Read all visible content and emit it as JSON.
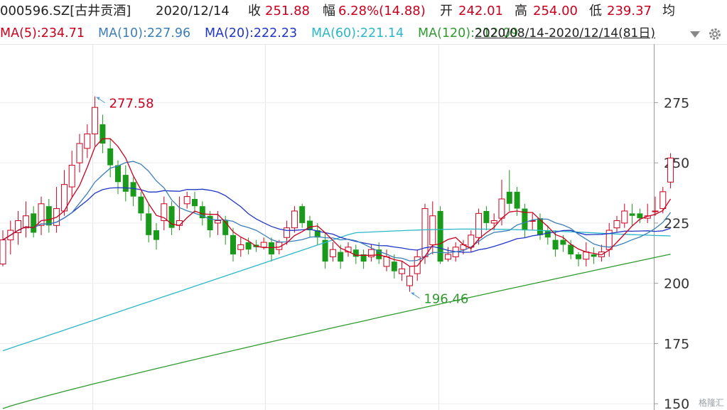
{
  "header": {
    "code": "000596.SZ[古井贡酒]",
    "date": "2020/12/14",
    "close": {
      "label": "收",
      "value": "251.88"
    },
    "change": {
      "label": "幅",
      "value": "6.28%(14.88)"
    },
    "open": {
      "label": "开",
      "value": "242.01"
    },
    "high": {
      "label": "高",
      "value": "254.00"
    },
    "low": {
      "label": "低",
      "value": "239.37"
    },
    "avg": {
      "label": "均"
    }
  },
  "ma_legend": [
    {
      "text": "MA(5):234.71",
      "color": "#c8001e"
    },
    {
      "text": "MA(10):227.96",
      "color": "#3c7fb8"
    },
    {
      "text": "MA(20):222.23",
      "color": "#1f36c7"
    },
    {
      "text": "MA(60):221.14",
      "color": "#2bb7c9"
    },
    {
      "text": "MA(120):212.09",
      "color": "#2f9a2f"
    }
  ],
  "range_label": "2020/08/14-2020/12/14(81日)",
  "watermark": "格隆汇",
  "chart_data": {
    "type": "candlestick",
    "y_ticks": [
      150,
      175,
      200,
      225,
      250,
      275
    ],
    "ylim": [
      147.4,
      299.3
    ],
    "annotations": [
      {
        "text": "277.58",
        "index": 12,
        "price": 277.58,
        "color": "#c8001e"
      },
      {
        "text": "196.46",
        "index": 53,
        "price": 196.46,
        "color": "#2f9a2f"
      }
    ],
    "colors": {
      "up": "#c8001e",
      "down": "#1a9a1a"
    },
    "candles": [
      [
        208,
        218,
        222,
        207
      ],
      [
        218,
        222,
        226,
        212
      ],
      [
        221,
        226,
        230,
        216
      ],
      [
        223,
        228,
        234,
        219
      ],
      [
        229,
        221,
        232,
        219
      ],
      [
        224,
        233,
        236,
        220
      ],
      [
        232,
        224,
        235,
        221
      ],
      [
        224,
        231,
        240,
        221
      ],
      [
        230,
        241,
        247,
        228
      ],
      [
        240,
        249,
        255,
        236
      ],
      [
        250,
        258,
        262,
        246
      ],
      [
        256,
        262,
        266,
        252
      ],
      [
        262,
        273,
        277.58,
        257
      ],
      [
        266,
        258,
        270,
        254
      ],
      [
        256,
        249,
        260,
        244
      ],
      [
        249,
        242,
        251,
        237
      ],
      [
        245,
        238,
        249,
        234
      ],
      [
        242,
        236,
        244,
        232
      ],
      [
        236,
        229,
        238,
        226
      ],
      [
        229,
        220,
        233,
        217
      ],
      [
        222,
        218,
        225,
        214
      ],
      [
        226,
        233,
        236,
        222
      ],
      [
        232,
        223,
        234,
        220
      ],
      [
        224,
        226,
        236,
        222
      ],
      [
        233,
        236,
        238,
        231
      ],
      [
        235,
        232,
        238,
        229
      ],
      [
        232,
        227,
        234,
        224
      ],
      [
        228,
        222,
        230,
        219
      ],
      [
        225,
        226,
        230,
        220
      ],
      [
        226,
        220,
        228,
        216
      ],
      [
        220,
        212,
        223,
        209
      ],
      [
        214,
        216,
        219,
        211
      ],
      [
        217,
        214,
        219,
        212
      ],
      [
        216,
        215,
        218,
        213
      ],
      [
        215,
        217,
        219,
        214
      ],
      [
        217,
        212,
        219,
        209
      ],
      [
        214,
        217,
        218,
        212
      ],
      [
        219,
        223,
        226,
        216
      ],
      [
        223,
        230,
        232,
        221
      ],
      [
        232,
        225,
        233,
        223
      ],
      [
        226,
        222,
        228,
        219
      ],
      [
        222,
        219,
        225,
        216
      ],
      [
        218,
        209,
        221,
        206
      ],
      [
        211,
        214,
        217,
        209
      ],
      [
        213,
        209,
        216,
        206
      ],
      [
        213,
        215,
        217,
        211
      ],
      [
        214,
        211,
        216,
        208
      ],
      [
        212,
        209,
        214,
        206
      ],
      [
        211,
        214,
        216,
        209
      ],
      [
        214,
        210,
        217,
        208
      ],
      [
        207,
        211,
        214,
        205
      ],
      [
        209,
        205,
        212,
        202
      ],
      [
        204,
        206,
        209,
        201
      ],
      [
        199,
        203,
        207,
        196.46
      ],
      [
        204,
        211,
        214,
        201
      ],
      [
        211,
        231,
        233,
        208
      ],
      [
        216,
        228,
        234,
        212
      ],
      [
        230,
        209,
        232,
        208
      ],
      [
        210,
        212,
        215,
        209
      ],
      [
        211,
        215,
        217,
        209
      ],
      [
        214,
        216,
        218,
        212
      ],
      [
        215,
        220,
        222,
        213
      ],
      [
        219,
        229,
        231,
        216
      ],
      [
        230,
        225,
        232,
        222
      ],
      [
        225,
        226,
        229,
        222
      ],
      [
        227,
        235,
        243,
        224
      ],
      [
        238,
        233,
        247,
        230
      ],
      [
        238,
        231,
        240,
        228
      ],
      [
        231,
        222,
        233,
        219
      ],
      [
        226,
        226,
        229,
        222
      ],
      [
        227,
        220,
        229,
        218
      ],
      [
        222,
        219,
        224,
        216
      ],
      [
        218,
        214,
        222,
        211
      ],
      [
        218,
        216,
        220,
        213
      ],
      [
        216,
        212,
        218,
        210
      ],
      [
        212,
        210,
        213,
        207
      ],
      [
        210,
        213,
        217,
        207
      ],
      [
        212,
        211,
        215,
        208
      ],
      [
        211,
        213,
        216,
        209
      ],
      [
        214,
        222,
        225,
        211
      ],
      [
        223,
        226,
        228,
        221
      ],
      [
        225,
        230,
        233,
        223
      ],
      [
        229,
        228,
        233,
        224
      ],
      [
        229,
        227,
        231,
        225
      ],
      [
        227,
        228,
        233,
        225
      ],
      [
        230,
        230,
        236,
        228
      ],
      [
        231,
        238,
        240,
        229
      ],
      [
        242,
        252,
        254,
        239.37
      ]
    ]
  }
}
